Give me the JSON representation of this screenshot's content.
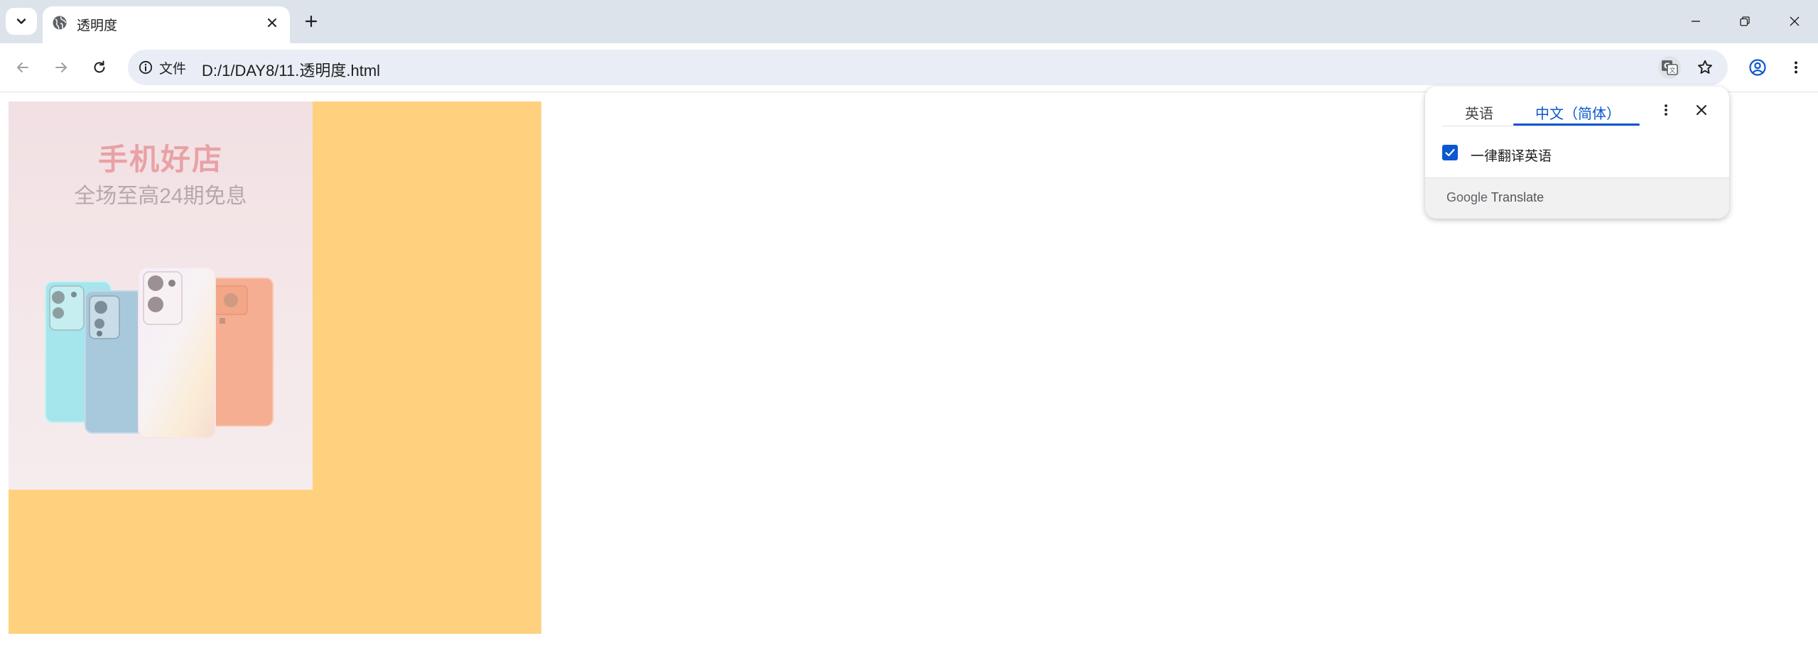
{
  "tab": {
    "title": "透明度",
    "favicon": "globe-icon"
  },
  "toolbar": {
    "site_info_label": "文件",
    "url": "D:/1/DAY8/11.透明度.html"
  },
  "page": {
    "promo_title": "手机好店",
    "promo_subtitle": "全场至高24期免息",
    "box_color": "#ffd17f"
  },
  "translate_popup": {
    "source_language": "英语",
    "target_language": "中文（简体）",
    "always_translate_label": "一律翻译英语",
    "always_translate_checked": true,
    "footer_brand": "Google",
    "footer_product": "Translate"
  },
  "colors": {
    "accent": "#0b57d0",
    "tabstrip": "#dde3ea",
    "omnibox": "#e9eef6"
  }
}
